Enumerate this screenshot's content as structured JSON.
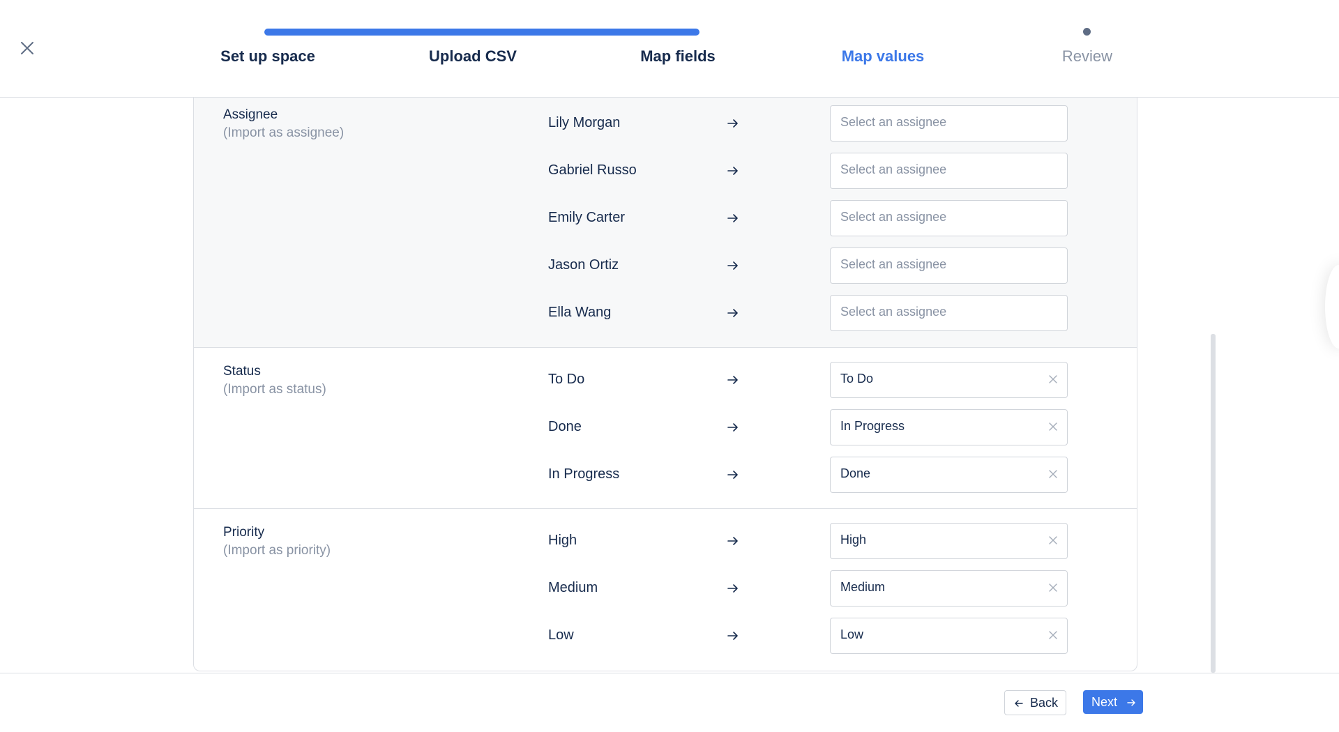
{
  "wizard": {
    "progress": 0.7,
    "steps": [
      {
        "label": "Set up space",
        "state": "done"
      },
      {
        "label": "Upload CSV",
        "state": "done"
      },
      {
        "label": "Map fields",
        "state": "done"
      },
      {
        "label": "Map values",
        "state": "active"
      },
      {
        "label": "Review",
        "state": "pending"
      }
    ]
  },
  "icons": {
    "close": "close-icon",
    "arrow": "arrow-right-icon",
    "clear": "clear-icon",
    "back": "arrow-left-icon",
    "next": "arrow-right-icon"
  },
  "colors": {
    "accent": "#3c78e8",
    "text": "#172b4d",
    "muted": "#8993a4",
    "border": "#dcdfe4",
    "section_bg": "#f7f8f9"
  },
  "sections": {
    "assignee": {
      "title": "Assignee",
      "subtitle": "(Import as assignee)",
      "rows": [
        {
          "source": "Lily Morgan",
          "target": "Select an assignee"
        },
        {
          "source": "Gabriel Russo",
          "target": "Select an assignee"
        },
        {
          "source": "Emily Carter",
          "target": "Select an assignee"
        },
        {
          "source": "Jason Ortiz",
          "target": "Select an assignee"
        },
        {
          "source": "Ella Wang",
          "target": "Select an assignee"
        }
      ]
    },
    "status": {
      "title": "Status",
      "subtitle": "(Import as status)",
      "rows": [
        {
          "source": "To Do",
          "target": "To Do"
        },
        {
          "source": "Done",
          "target": "In Progress"
        },
        {
          "source": "In Progress",
          "target": "Done"
        }
      ]
    },
    "priority": {
      "title": "Priority",
      "subtitle": "(Import as priority)",
      "rows": [
        {
          "source": "High",
          "target": "High"
        },
        {
          "source": "Medium",
          "target": "Medium"
        },
        {
          "source": "Low",
          "target": "Low"
        }
      ]
    }
  },
  "footer": {
    "back_label": "Back",
    "next_label": "Next"
  }
}
